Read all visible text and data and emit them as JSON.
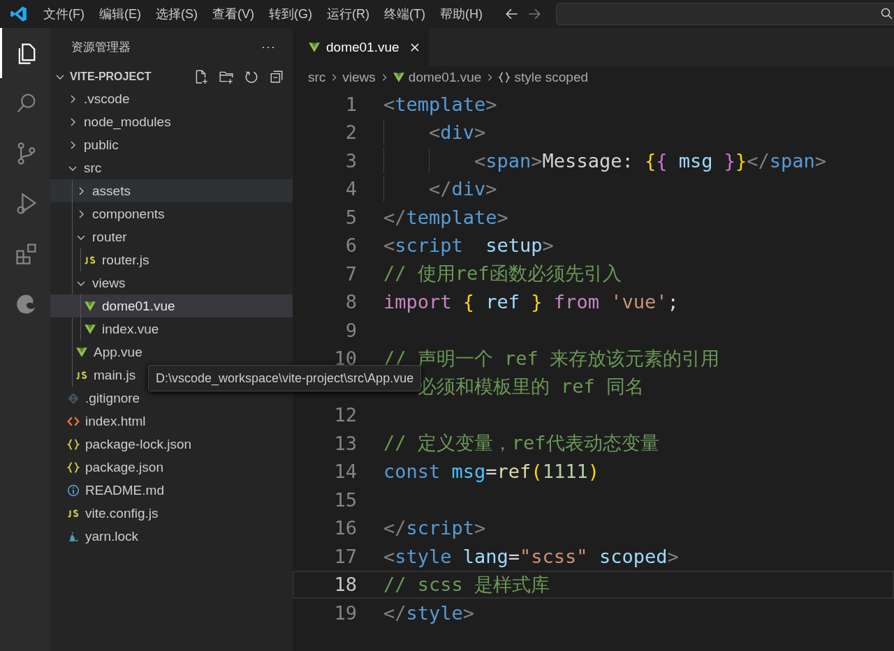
{
  "menu": [
    "文件(F)",
    "编辑(E)",
    "选择(S)",
    "查看(V)",
    "转到(G)",
    "运行(R)",
    "终端(T)",
    "帮助(H)"
  ],
  "activity_bar": [
    {
      "kind": "explorer",
      "selected": true
    },
    {
      "kind": "search",
      "selected": false
    },
    {
      "kind": "source-control",
      "selected": false
    },
    {
      "kind": "run-debug",
      "selected": false
    },
    {
      "kind": "extensions",
      "selected": false
    },
    {
      "kind": "edge",
      "selected": false
    }
  ],
  "sidebar": {
    "title": "资源管理器",
    "more": "···",
    "project": "VITE-PROJECT",
    "project_expanded": true,
    "items": [
      {
        "name": ".vscode",
        "kind": "folder",
        "expanded": false,
        "selected": false,
        "hovered": false
      },
      {
        "name": "node_modules",
        "kind": "folder",
        "expanded": false,
        "selected": false,
        "hovered": false
      },
      {
        "name": "public",
        "kind": "folder",
        "expanded": false,
        "selected": false,
        "hovered": false
      },
      {
        "name": "src",
        "kind": "folder",
        "expanded": true,
        "selected": false,
        "hovered": false,
        "children": [
          {
            "name": "assets",
            "kind": "folder",
            "expanded": false,
            "selected": false,
            "hovered": true
          },
          {
            "name": "components",
            "kind": "folder",
            "expanded": false,
            "selected": false,
            "hovered": false
          },
          {
            "name": "router",
            "kind": "folder",
            "expanded": true,
            "selected": false,
            "hovered": false,
            "children": [
              {
                "name": "router.js",
                "kind": "js",
                "selected": false,
                "hovered": false
              }
            ]
          },
          {
            "name": "views",
            "kind": "folder",
            "expanded": true,
            "selected": false,
            "hovered": false,
            "children": [
              {
                "name": "dome01.vue",
                "kind": "vue",
                "selected": true,
                "hovered": false
              },
              {
                "name": "index.vue",
                "kind": "vue",
                "selected": false,
                "hovered": false
              }
            ]
          },
          {
            "name": "App.vue",
            "kind": "vue",
            "selected": false,
            "hovered": false
          },
          {
            "name": "main.js",
            "kind": "js",
            "selected": false,
            "hovered": false
          }
        ]
      },
      {
        "name": ".gitignore",
        "kind": "git",
        "selected": false,
        "hovered": false
      },
      {
        "name": "index.html",
        "kind": "html",
        "selected": false,
        "hovered": false
      },
      {
        "name": "package-lock.json",
        "kind": "json",
        "selected": false,
        "hovered": false
      },
      {
        "name": "package.json",
        "kind": "json",
        "selected": false,
        "hovered": false
      },
      {
        "name": "README.md",
        "kind": "info",
        "selected": false,
        "hovered": false
      },
      {
        "name": "vite.config.js",
        "kind": "js",
        "selected": false,
        "hovered": false
      },
      {
        "name": "yarn.lock",
        "kind": "yarn",
        "selected": false,
        "hovered": false
      }
    ]
  },
  "tooltip": "D:\\vscode_workspace\\vite-project\\src\\App.vue",
  "tabs": [
    {
      "label": "dome01.vue",
      "kind": "vue",
      "selected": true
    }
  ],
  "breadcrumb": [
    {
      "label": "src",
      "kind": "folder"
    },
    {
      "label": "views",
      "kind": "folder"
    },
    {
      "label": "dome01.vue",
      "kind": "vue"
    },
    {
      "label": "style scoped",
      "kind": "symbol"
    }
  ],
  "code": [
    {
      "number": "1",
      "current": false,
      "covered": false,
      "tokens": [
        {
          "kind": "punct",
          "text": "<"
        },
        {
          "kind": "tag",
          "text": "template"
        },
        {
          "kind": "punct",
          "text": ">"
        }
      ]
    },
    {
      "number": "2",
      "current": false,
      "covered": false,
      "tokens": [
        {
          "kind": "punct",
          "text": "    <"
        },
        {
          "kind": "tag",
          "text": "div"
        },
        {
          "kind": "punct",
          "text": ">"
        }
      ]
    },
    {
      "number": "3",
      "current": false,
      "covered": false,
      "tokens": [
        {
          "kind": "punct",
          "text": "        <"
        },
        {
          "kind": "tag",
          "text": "span"
        },
        {
          "kind": "punct",
          "text": ">"
        },
        {
          "kind": "text",
          "text": "Message: "
        },
        {
          "kind": "brace1",
          "text": "{"
        },
        {
          "kind": "brace2",
          "text": "{"
        },
        {
          "kind": "var",
          "text": " msg "
        },
        {
          "kind": "brace2",
          "text": "}"
        },
        {
          "kind": "brace1",
          "text": "}"
        },
        {
          "kind": "punct",
          "text": "</"
        },
        {
          "kind": "tag",
          "text": "span"
        },
        {
          "kind": "punct",
          "text": ">"
        }
      ]
    },
    {
      "number": "4",
      "current": false,
      "covered": false,
      "tokens": [
        {
          "kind": "punct",
          "text": "    </"
        },
        {
          "kind": "tag",
          "text": "div"
        },
        {
          "kind": "punct",
          "text": ">"
        }
      ]
    },
    {
      "number": "5",
      "current": false,
      "covered": false,
      "tokens": [
        {
          "kind": "punct",
          "text": "</"
        },
        {
          "kind": "tag",
          "text": "template"
        },
        {
          "kind": "punct",
          "text": ">"
        }
      ]
    },
    {
      "number": "6",
      "current": false,
      "covered": false,
      "tokens": [
        {
          "kind": "punct",
          "text": "<"
        },
        {
          "kind": "tag",
          "text": "script"
        },
        {
          "kind": "attr",
          "text": "  setup"
        },
        {
          "kind": "punct",
          "text": ">"
        }
      ]
    },
    {
      "number": "7",
      "current": false,
      "covered": false,
      "tokens": [
        {
          "kind": "comment",
          "text": "// 使用ref函数必须先引入"
        }
      ]
    },
    {
      "number": "8",
      "current": false,
      "covered": false,
      "tokens": [
        {
          "kind": "keyword",
          "text": "import"
        },
        {
          "kind": "brace1",
          "text": " {"
        },
        {
          "kind": "var",
          "text": " ref "
        },
        {
          "kind": "brace1",
          "text": "}"
        },
        {
          "kind": "keyword",
          "text": " from"
        },
        {
          "kind": "string",
          "text": " 'vue'"
        },
        {
          "kind": "plain",
          "text": ";"
        }
      ]
    },
    {
      "number": "9",
      "current": false,
      "covered": false
    },
    {
      "number": "10",
      "current": false,
      "covered": false,
      "tokens": [
        {
          "kind": "comment",
          "text": "// 声明一个 ref 来存放该元素的引用"
        }
      ]
    },
    {
      "current": false,
      "covered": true,
      "tokens": [
        {
          "kind": "comment",
          "text": "必须和模板里的 ref 同名"
        }
      ]
    },
    {
      "number": "12",
      "current": false,
      "covered": false
    },
    {
      "number": "13",
      "current": false,
      "covered": false,
      "tokens": [
        {
          "kind": "comment",
          "text": "// 定义变量，ref代表动态变量"
        }
      ]
    },
    {
      "number": "14",
      "current": false,
      "covered": false,
      "tokens": [
        {
          "kind": "storage",
          "text": "const"
        },
        {
          "kind": "const",
          "text": " msg"
        },
        {
          "kind": "plain",
          "text": "="
        },
        {
          "kind": "func",
          "text": "ref"
        },
        {
          "kind": "brace1",
          "text": "("
        },
        {
          "kind": "number",
          "text": "1111"
        },
        {
          "kind": "brace1",
          "text": ")"
        }
      ]
    },
    {
      "number": "15",
      "current": false,
      "covered": false
    },
    {
      "number": "16",
      "current": false,
      "covered": false,
      "tokens": [
        {
          "kind": "punct",
          "text": "</"
        },
        {
          "kind": "tag",
          "text": "script"
        },
        {
          "kind": "punct",
          "text": ">"
        }
      ]
    },
    {
      "number": "17",
      "current": false,
      "covered": false,
      "tokens": [
        {
          "kind": "punct",
          "text": "<"
        },
        {
          "kind": "tag",
          "text": "style"
        },
        {
          "kind": "attr",
          "text": " lang"
        },
        {
          "kind": "plain",
          "text": "="
        },
        {
          "kind": "string",
          "text": "\"scss\""
        },
        {
          "kind": "attr",
          "text": " scoped"
        },
        {
          "kind": "punct",
          "text": ">"
        }
      ]
    },
    {
      "number": "18",
      "current": true,
      "covered": false,
      "tokens": [
        {
          "kind": "comment",
          "text": "// scss 是样式库"
        }
      ]
    },
    {
      "number": "19",
      "current": false,
      "covered": false,
      "tokens": [
        {
          "kind": "punct",
          "text": "</"
        },
        {
          "kind": "tag",
          "text": "style"
        },
        {
          "kind": "punct",
          "text": ">"
        }
      ]
    }
  ]
}
